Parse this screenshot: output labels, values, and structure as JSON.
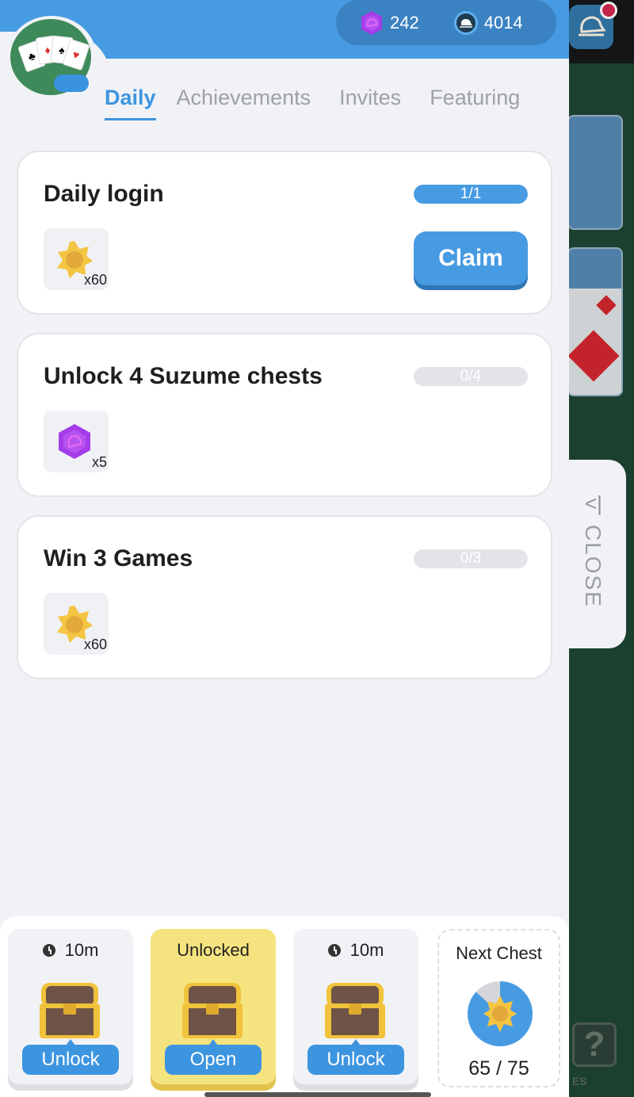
{
  "currency": {
    "gems": "242",
    "coins": "4014"
  },
  "tabs": [
    {
      "label": "Daily",
      "active": true
    },
    {
      "label": "Achievements",
      "active": false
    },
    {
      "label": "Invites",
      "active": false
    },
    {
      "label": "Featuring",
      "active": false
    }
  ],
  "tasks": [
    {
      "title": "Daily login",
      "progress_text": "1/1",
      "progress": 1.0,
      "reward_type": "coin-badge",
      "reward_qty": "x60",
      "claim_label": "Claim"
    },
    {
      "title": "Unlock 4 Suzume chests",
      "progress_text": "0/4",
      "progress": 0.0,
      "reward_type": "gem",
      "reward_qty": "x5"
    },
    {
      "title": "Win 3 Games",
      "progress_text": "0/3",
      "progress": 0.0,
      "reward_type": "coin-badge",
      "reward_qty": "x60"
    }
  ],
  "close_tab": {
    "label": "CLOSE",
    "icon": "collapse-left-icon"
  },
  "chests": [
    {
      "status": "10m",
      "timer": true,
      "button": "Unlock",
      "unlocked": false
    },
    {
      "status": "Unlocked",
      "timer": false,
      "button": "Open",
      "unlocked": true
    },
    {
      "status": "10m",
      "timer": true,
      "button": "Unlock",
      "unlocked": false
    }
  ],
  "next_chest": {
    "title": "Next Chest",
    "count": "65 / 75",
    "progress": 0.867
  },
  "background": {
    "help_label": "ES"
  },
  "colors": {
    "primary": "#479be3",
    "gem": "#a43ce8",
    "gold": "#f4c542",
    "unlocked_bg": "#f5e37f"
  }
}
